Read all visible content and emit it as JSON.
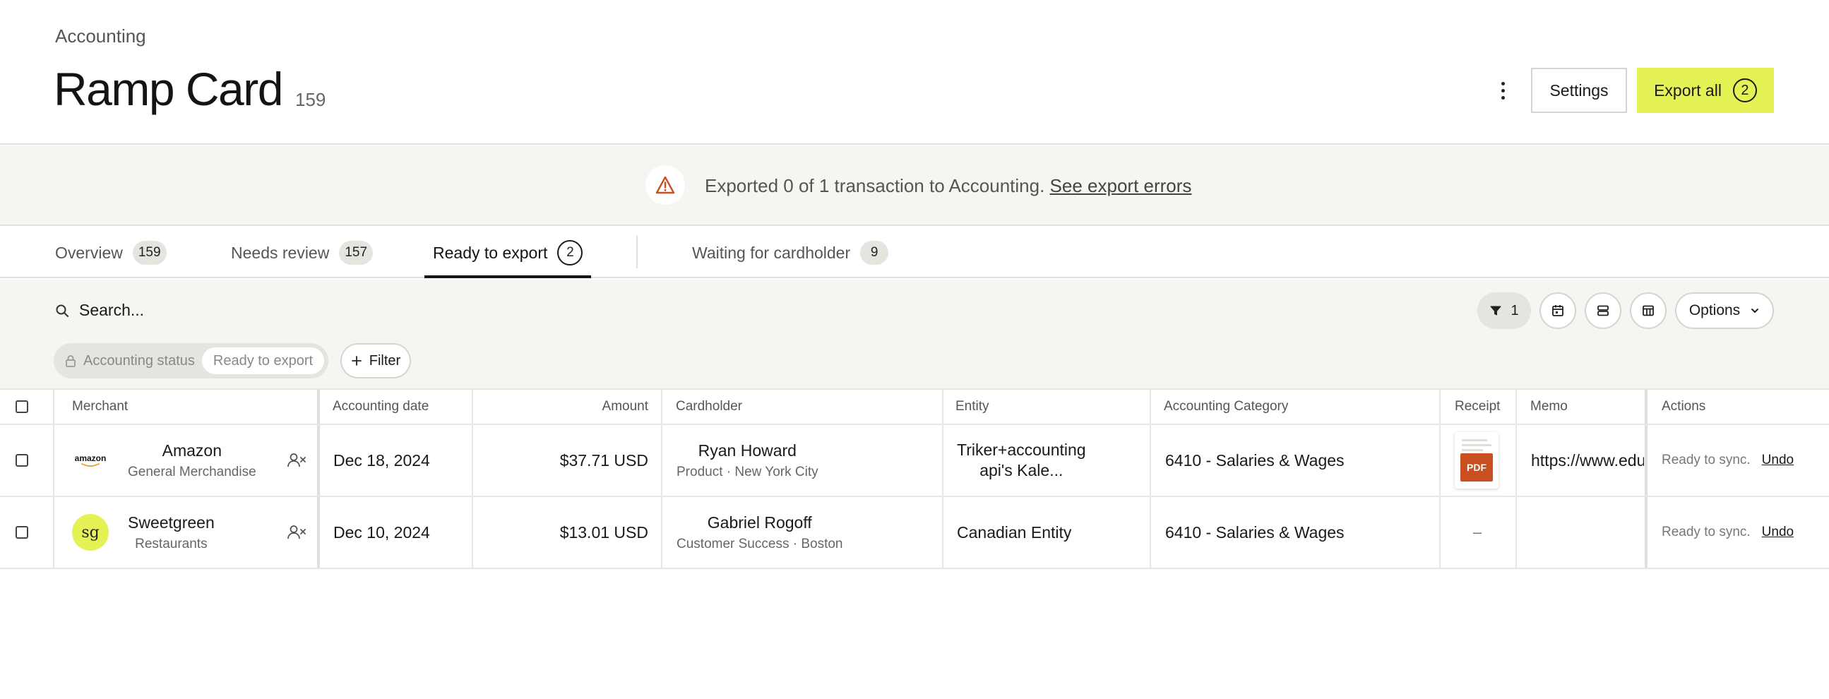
{
  "header": {
    "breadcrumb": "Accounting",
    "title": "Ramp Card",
    "count": "159",
    "settings_label": "Settings",
    "export_label": "Export all",
    "export_count": "2"
  },
  "banner": {
    "message": "Exported 0 of 1 transaction to Accounting.",
    "link": "See export errors"
  },
  "tabs": [
    {
      "label": "Overview",
      "count": "159"
    },
    {
      "label": "Needs review",
      "count": "157"
    },
    {
      "label": "Ready to export",
      "count": "2"
    },
    {
      "label": "Waiting for cardholder",
      "count": "9"
    }
  ],
  "toolbar": {
    "search_placeholder": "Search...",
    "filter_count": "1",
    "options_label": "Options",
    "chip_label": "Accounting status",
    "chip_value": "Ready to export",
    "filter_label": "Filter"
  },
  "table": {
    "columns": [
      "Merchant",
      "Accounting date",
      "Amount",
      "Cardholder",
      "Entity",
      "Accounting Category",
      "Receipt",
      "Memo",
      "Actions"
    ],
    "rows": [
      {
        "merchant": "Amazon",
        "merchant_category": "General Merchandise",
        "logo_text": "amazon",
        "date": "Dec 18, 2024",
        "amount": "$37.71 USD",
        "cardholder": "Ryan Howard",
        "cardholder_detail": "Product · New York City",
        "entity_line1": "Triker+accounting",
        "entity_line2": "api's Kale...",
        "category": "6410 - Salaries & Wages",
        "receipt": "PDF",
        "memo": "https://www.edu",
        "status": "Ready to sync.",
        "action": "Undo"
      },
      {
        "merchant": "Sweetgreen",
        "merchant_category": "Restaurants",
        "logo_text": "sg",
        "date": "Dec 10, 2024",
        "amount": "$13.01 USD",
        "cardholder": "Gabriel Rogoff",
        "cardholder_detail": "Customer Success · Boston",
        "entity_line1": "Canadian Entity",
        "category": "6410 - Salaries & Wages",
        "receipt": "–",
        "memo": "",
        "status": "Ready to sync.",
        "action": "Undo"
      }
    ]
  },
  "colors": {
    "accent": "#e4f256",
    "pdf": "#c94f21",
    "warning": "#c94f21"
  }
}
